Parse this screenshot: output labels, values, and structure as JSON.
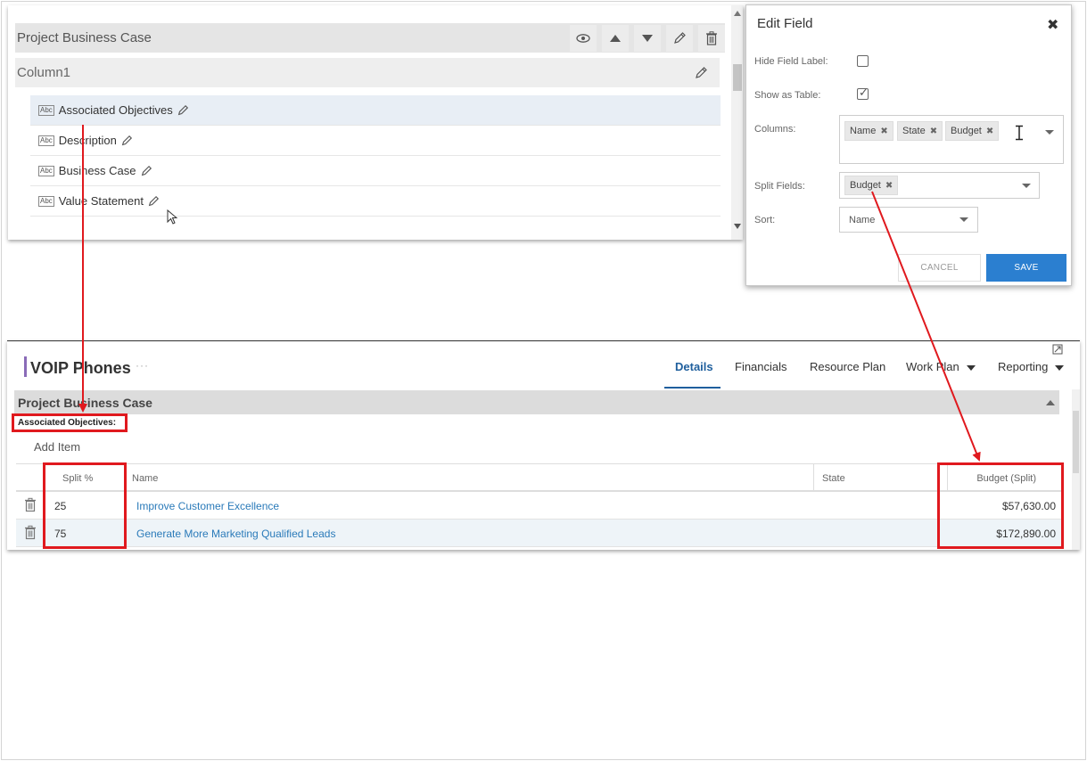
{
  "builder": {
    "section_title": "Project Business Case",
    "column_title": "Column1",
    "fields": [
      {
        "icon_text": "Abc",
        "label": "Associated Objectives"
      },
      {
        "icon_text": "Abc",
        "label": "Description"
      },
      {
        "icon_text": "Abc",
        "label": "Business Case"
      },
      {
        "icon_text": "Abc",
        "label": "Value Statement"
      }
    ]
  },
  "dialog": {
    "title": "Edit Field",
    "close_symbol": "✖",
    "hide_label": "Hide Field Label:",
    "show_table": "Show as Table:",
    "columns_label": "Columns:",
    "columns": [
      "Name",
      "State",
      "Budget"
    ],
    "split_label": "Split Fields:",
    "split_fields": [
      "Budget"
    ],
    "sort_label": "Sort:",
    "sort_value": "Name",
    "cancel": "CANCEL",
    "save": "SAVE",
    "chip_remove": "✖",
    "show_table_checked": true,
    "hide_label_checked": false,
    "save_color": "#2b7fd0"
  },
  "page": {
    "title": "VOIP Phones",
    "more": "···",
    "tabs": [
      {
        "label": "Details",
        "active": true
      },
      {
        "label": "Financials"
      },
      {
        "label": "Resource Plan"
      },
      {
        "label": "Work Plan",
        "dropdown": true
      },
      {
        "label": "Reporting",
        "dropdown": true
      }
    ],
    "section_title": "Project Business Case",
    "assoc_label": "Associated Objectives:",
    "add_item": "Add Item",
    "table": {
      "headers": [
        "Split %",
        "Name",
        "State",
        "Budget (Split)"
      ],
      "rows": [
        {
          "split": "25",
          "name": "Improve Customer Excellence",
          "state": "",
          "budget": "$57,630.00"
        },
        {
          "split": "75",
          "name": "Generate More Marketing Qualified Leads",
          "state": "",
          "budget": "$172,890.00"
        }
      ]
    },
    "accent_color": "#8a6bb8",
    "link_color": "#2a7ab9"
  },
  "annotation_color": "#e0191e"
}
